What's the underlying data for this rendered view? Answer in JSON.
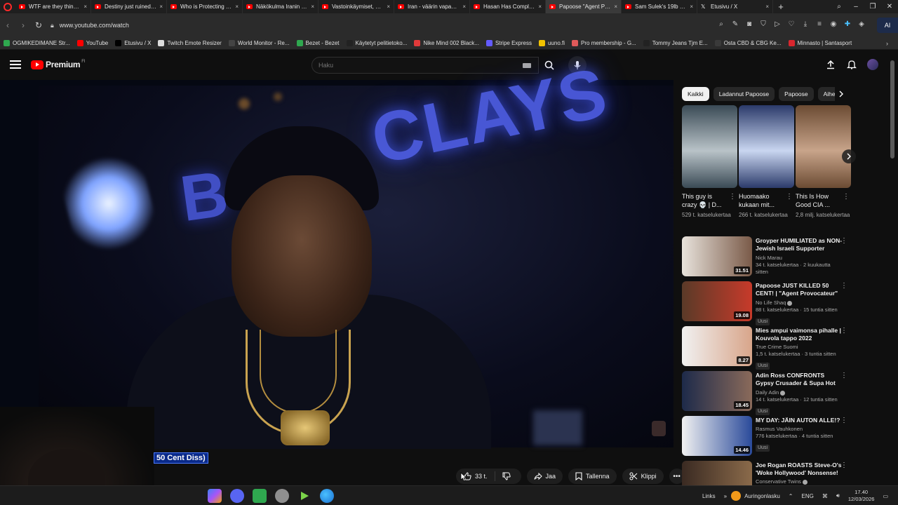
{
  "browser": {
    "tabs": [
      {
        "label": "WTF are they thinking? -",
        "icon": "youtube-icon",
        "active": false
      },
      {
        "label": "Destiny just ruined his ca",
        "icon": "youtube-icon",
        "active": false
      },
      {
        "label": "Who is Protecting the Je",
        "icon": "youtube-icon",
        "active": false
      },
      {
        "label": "Näkökulma Iranin tapah",
        "icon": "youtube-icon",
        "active": false
      },
      {
        "label": "Vastoinkäymiset, UFC-ur",
        "icon": "youtube-icon",
        "active": false
      },
      {
        "label": "Iran - väärin vapautettu?",
        "icon": "youtube-icon",
        "active": false
      },
      {
        "label": "Hasan Has Completely L",
        "icon": "youtube-icon",
        "active": false
      },
      {
        "label": "Papoose \"Agent Provo",
        "icon": "youtube-icon",
        "active": true
      },
      {
        "label": "Sam Sulek's 19lb Post Sh",
        "icon": "youtube-icon",
        "active": false
      },
      {
        "label": "Etusivu / X",
        "icon": "x-icon",
        "active": false
      }
    ],
    "url": "www.youtube.com/watch",
    "ai_button": "AI",
    "bookmarks": [
      {
        "label": "OGMIKEDIMANE Str...",
        "color": "#2fa84f"
      },
      {
        "label": "YouTube",
        "color": "#ff0000"
      },
      {
        "label": "Etusivu / X",
        "color": "#000000"
      },
      {
        "label": "Twitch Emote Resizer",
        "color": "#dddddd"
      },
      {
        "label": "World Monitor - Re...",
        "color": "#444444"
      },
      {
        "label": "Bezet - Bezet",
        "color": "#2fa84f"
      },
      {
        "label": "Käytetyt pelitietoko...",
        "color": "#222222"
      },
      {
        "label": "Nike Mind 002 Black...",
        "color": "#e03a3a"
      },
      {
        "label": "Stripe Express",
        "color": "#635bff"
      },
      {
        "label": "uuno.fi",
        "color": "#f2c200"
      },
      {
        "label": "Pro membership - G...",
        "color": "#e05a5a"
      },
      {
        "label": "Tommy Jeans Tjm E...",
        "color": "#222222"
      },
      {
        "label": "Osta CBD & CBG Ke...",
        "color": "#3a3a3a"
      },
      {
        "label": "Minnasto | Santasport",
        "color": "#d9262e"
      }
    ]
  },
  "youtube": {
    "brand": "Premium",
    "country": "FI",
    "search_placeholder": "Haku"
  },
  "player": {
    "caption": "50 Cent Diss)"
  },
  "actions": {
    "likes": "33 t.",
    "share": "Jaa",
    "save": "Tallenna",
    "clip": "Klippi"
  },
  "sidebar": {
    "chips": [
      "Kaikki",
      "Ladannut Papoose",
      "Papoose",
      "Aihe"
    ],
    "shorts": [
      {
        "title": "This guy is crazy 💀 | D...",
        "views": "529 t. katselukertaa",
        "colors": [
          "#3a4a55",
          "#b9c3c8"
        ]
      },
      {
        "title": "Huomaako kukaan mit...",
        "views": "266 t. katselukertaa",
        "colors": [
          "#2b3a6a",
          "#c9d6f0"
        ]
      },
      {
        "title": "This Is How Good CIA ...",
        "views": "2,8 milj. katselukertaa",
        "colors": [
          "#6b4b33",
          "#c8a48a"
        ]
      }
    ],
    "videos": [
      {
        "title": "Groyper HUMILIATED as NON-Jewish Israeli Supporter Lists...",
        "channel": "Nick Marau",
        "stats": "34 t. katselukertaa · 2 kuukautta sitten",
        "duration": "31.51",
        "new": "",
        "verified": false,
        "colors": [
          "#e8e3dc",
          "#7a5a48"
        ]
      },
      {
        "title": "Papoose JUST KILLED 50 CENT! | \"Agent Provocateur\" ...",
        "channel": "No Life Shaq",
        "stats": "88 t. katselukertaa · 15 tuntia sitten",
        "duration": "19.08",
        "new": "Uusi",
        "verified": true,
        "colors": [
          "#5a3a28",
          "#c73a2a"
        ]
      },
      {
        "title": "Mies ampui vaimonsa pihalle | Kouvola tappo 2022",
        "channel": "True Crime Suomi",
        "stats": "1,5 t. katselukertaa · 3 tuntia sitten",
        "duration": "8.27",
        "new": "Uusi",
        "verified": false,
        "colors": [
          "#f1f1f1",
          "#d8a58a"
        ]
      },
      {
        "title": "Adin Ross CONFRONTS Gypsy Crusader & Supa Hot Fire!...",
        "channel": "Daily Adin",
        "stats": "14 t. katselukertaa · 12 tuntia sitten",
        "duration": "18.45",
        "new": "Uusi",
        "verified": true,
        "colors": [
          "#1d2a4a",
          "#8a6a5a"
        ]
      },
      {
        "title": "MY DAY: JÄIN AUTON ALLE!?",
        "channel": "Rasmus Vauhkonen",
        "stats": "776 katselukertaa · 4 tuntia sitten",
        "duration": "14.46",
        "new": "Uusi",
        "verified": false,
        "colors": [
          "#f1f1f1",
          "#2a4a9a"
        ]
      },
      {
        "title": "Joe Rogan ROASTS Steve-O's 'Woke Hollywood' Nonsense!",
        "channel": "Conservative Twins",
        "stats": "",
        "duration": "",
        "new": "",
        "verified": true,
        "colors": [
          "#3a2a22",
          "#8a6a4a"
        ]
      }
    ]
  },
  "taskbar": {
    "links": "Links",
    "weather": "Auringonlasku",
    "language": "ENG",
    "time": "17.40",
    "date": "12/03/2026"
  }
}
